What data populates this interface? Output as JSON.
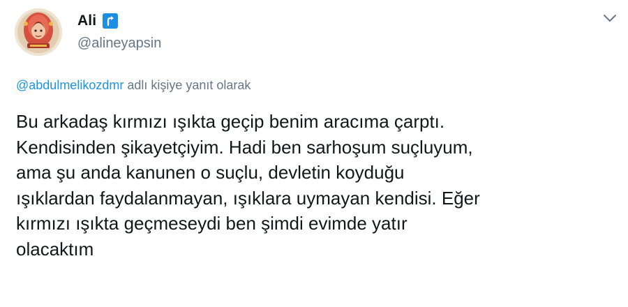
{
  "author": {
    "display_name": "Ali",
    "handle": "@alineyapsin",
    "avatar_icon": "avatar-illustration",
    "badge_icon": "curved-arrow-badge-icon",
    "badge_color": "#1d8fe3"
  },
  "menu": {
    "caret_icon": "chevron-down-icon"
  },
  "reply": {
    "mention": "@abdulmelikozdmr",
    "suffix": "adlı kişiye yanıt olarak"
  },
  "tweet": {
    "lines": [
      "Bu arkadaş kırmızı ışıkta geçip benim aracıma çarptı.",
      "Kendisinden şikayetçiyim. Hadi ben sarhoşum suçluyum,",
      "ama şu anda kanunen o suçlu, devletin koyduğu",
      "ışıklardan faydalanmayan, ışıklara uymayan kendisi. Eğer",
      "kırmızı ışıkta geçmeseydi ben şimdi evimde yatır",
      "olacaktım"
    ]
  },
  "colors": {
    "text": "#14171a",
    "secondary": "#657786",
    "link": "#1b95e0"
  }
}
